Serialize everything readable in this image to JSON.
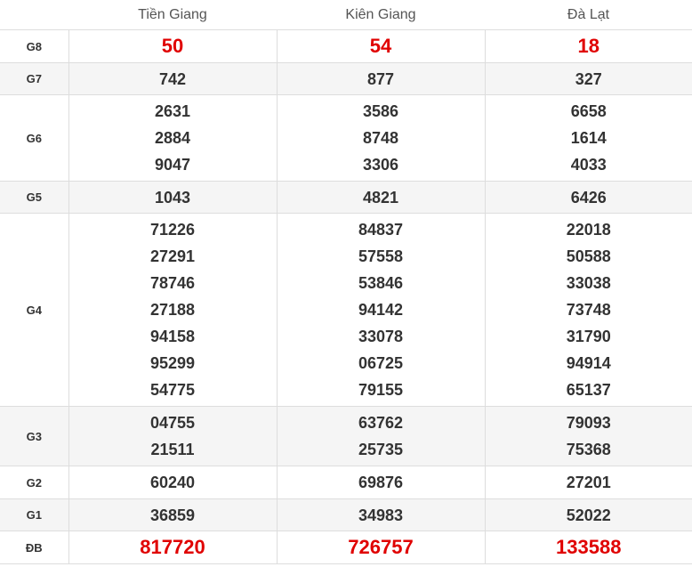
{
  "header": {
    "blank": "",
    "provinces": [
      "Tiền Giang",
      "Kiên Giang",
      "Đà Lạt"
    ]
  },
  "prizes": [
    {
      "label": "G8",
      "highlight": true,
      "values": [
        [
          "50"
        ],
        [
          "54"
        ],
        [
          "18"
        ]
      ]
    },
    {
      "label": "G7",
      "highlight": false,
      "values": [
        [
          "742"
        ],
        [
          "877"
        ],
        [
          "327"
        ]
      ]
    },
    {
      "label": "G6",
      "highlight": false,
      "values": [
        [
          "2631",
          "2884",
          "9047"
        ],
        [
          "3586",
          "8748",
          "3306"
        ],
        [
          "6658",
          "1614",
          "4033"
        ]
      ]
    },
    {
      "label": "G5",
      "highlight": false,
      "values": [
        [
          "1043"
        ],
        [
          "4821"
        ],
        [
          "6426"
        ]
      ]
    },
    {
      "label": "G4",
      "highlight": false,
      "values": [
        [
          "71226",
          "27291",
          "78746",
          "27188",
          "94158",
          "95299",
          "54775"
        ],
        [
          "84837",
          "57558",
          "53846",
          "94142",
          "33078",
          "06725",
          "79155"
        ],
        [
          "22018",
          "50588",
          "33038",
          "73748",
          "31790",
          "94914",
          "65137"
        ]
      ]
    },
    {
      "label": "G3",
      "highlight": false,
      "values": [
        [
          "04755",
          "21511"
        ],
        [
          "63762",
          "25735"
        ],
        [
          "79093",
          "75368"
        ]
      ]
    },
    {
      "label": "G2",
      "highlight": false,
      "values": [
        [
          "60240"
        ],
        [
          "69876"
        ],
        [
          "27201"
        ]
      ]
    },
    {
      "label": "G1",
      "highlight": false,
      "values": [
        [
          "36859"
        ],
        [
          "34983"
        ],
        [
          "52022"
        ]
      ]
    },
    {
      "label": "ĐB",
      "highlight": true,
      "values": [
        [
          "817720"
        ],
        [
          "726757"
        ],
        [
          "133588"
        ]
      ]
    }
  ],
  "colors": {
    "highlight": "#e00000",
    "text": "#333333",
    "stripe": "#f5f5f5",
    "border": "#dddddd"
  }
}
